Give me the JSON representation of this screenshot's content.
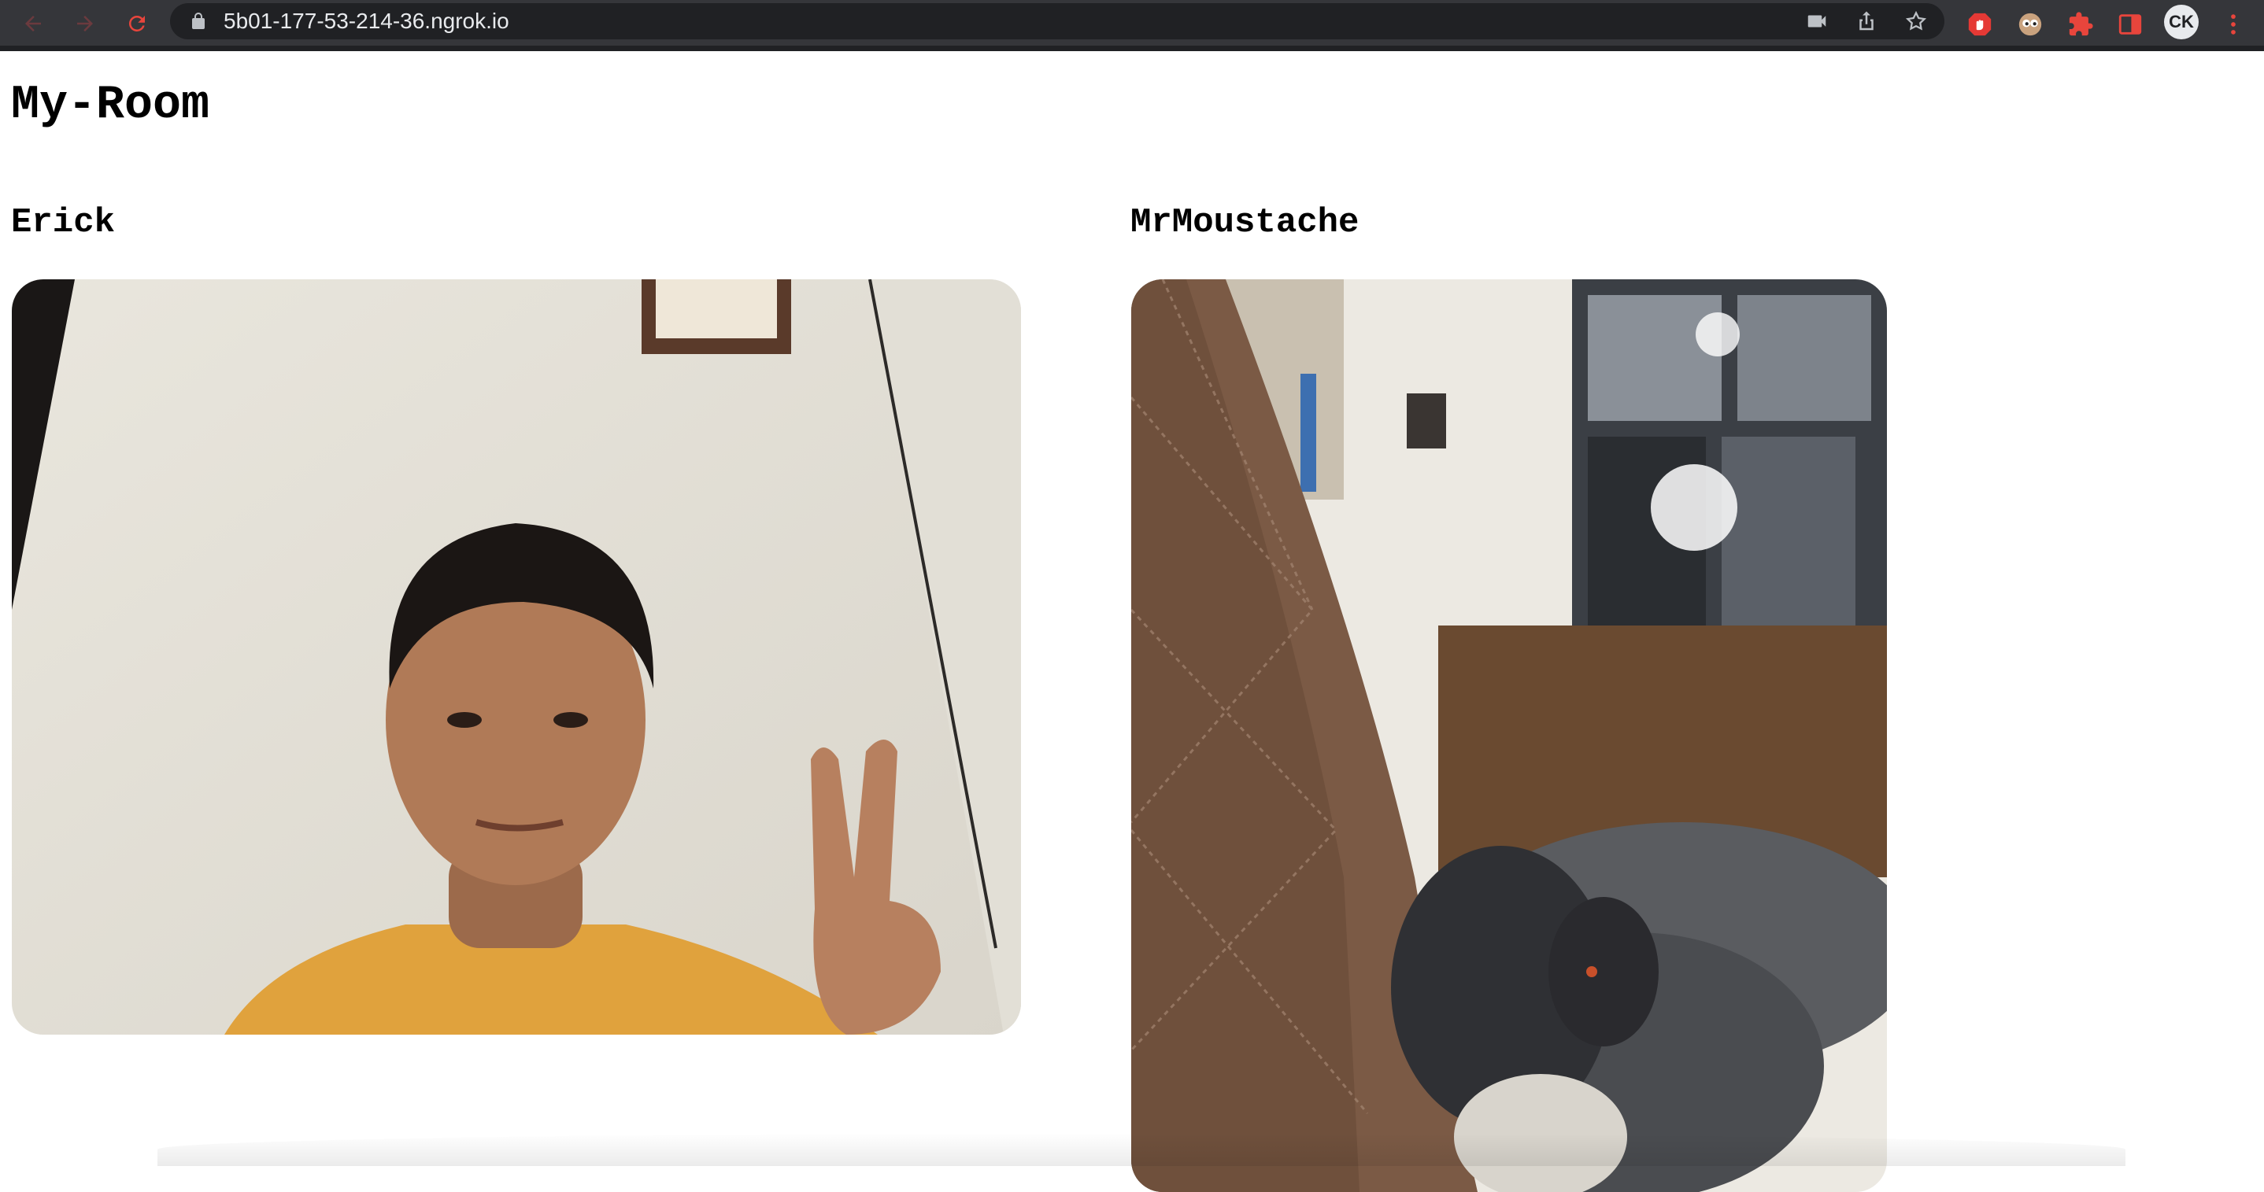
{
  "browser": {
    "url": "5b01-177-53-214-36.ngrok.io",
    "profile_initials": "CK",
    "icons": {
      "back": "arrow-left-icon",
      "forward": "arrow-right-icon",
      "reload": "reload-icon",
      "lock": "lock-icon",
      "camera": "video-camera-icon",
      "share": "share-icon",
      "bookmark": "star-icon",
      "extension_1": "stop-hand-icon",
      "extension_2": "eyes-icon",
      "extensions_menu": "puzzle-icon",
      "side_panel": "side-panel-icon",
      "menu": "kebab-menu-icon"
    },
    "colors": {
      "toolbar": "#35363a",
      "omnibox": "#202124",
      "nav_icon": "#e8453c",
      "url_text": "#e8eaed"
    }
  },
  "page": {
    "title": "My-Room",
    "peers": [
      {
        "name": "Erick",
        "video": "webcam-feed-person-peace-sign"
      },
      {
        "name": "MrMoustache",
        "video": "webcam-feed-sleeping-dog-on-couch"
      }
    ]
  }
}
